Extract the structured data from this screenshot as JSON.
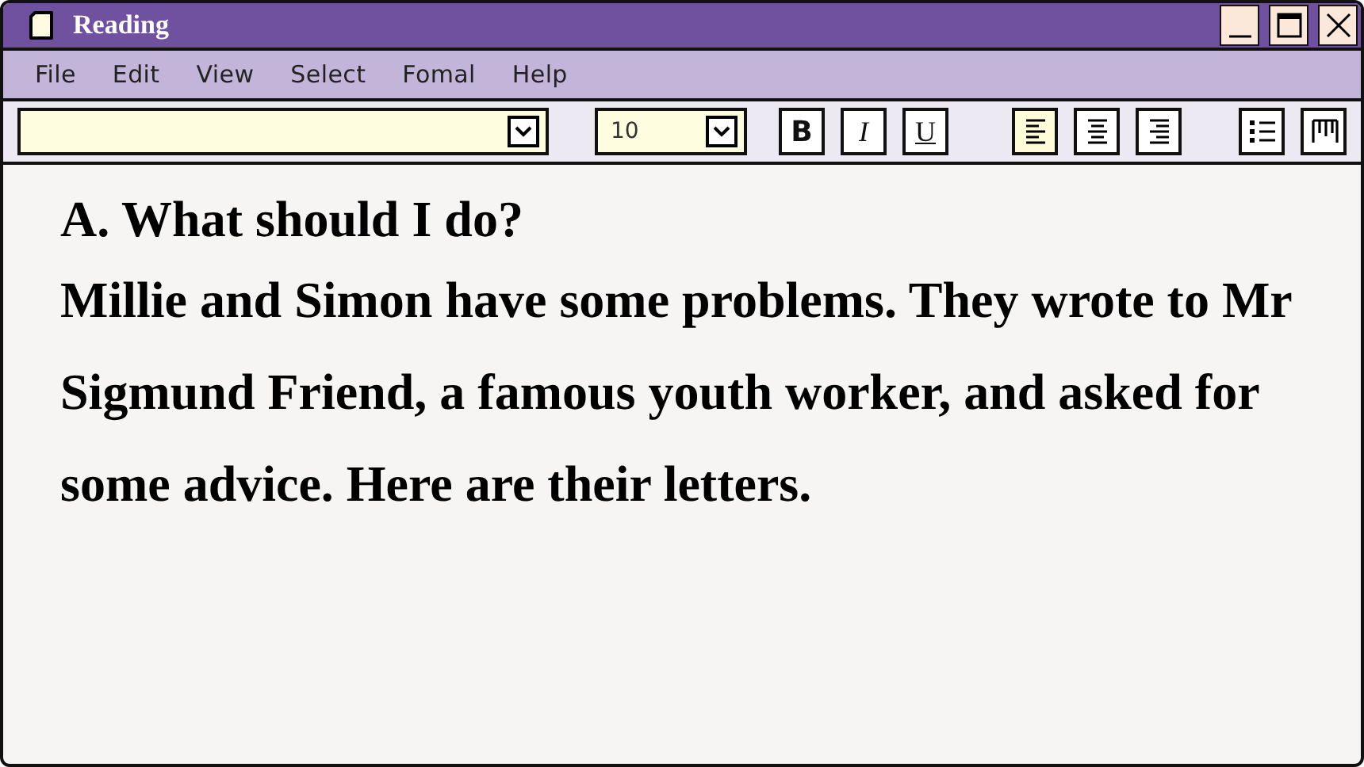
{
  "window": {
    "title": "Reading"
  },
  "menu": [
    "File",
    "Edit",
    "View",
    "Select",
    "Fomal",
    "Help"
  ],
  "toolbar": {
    "size": {
      "value": "10"
    },
    "styles": [
      {
        "label": "B",
        "kind": "bold"
      },
      {
        "label": "I",
        "kind": "italic"
      },
      {
        "label": "U",
        "kind": "underline"
      }
    ],
    "alignments": [
      {
        "kind": "left",
        "selected": true
      },
      {
        "kind": "center",
        "selected": false
      },
      {
        "kind": "right",
        "selected": false
      }
    ],
    "extras": [
      {
        "kind": "list"
      },
      {
        "kind": "columns"
      }
    ]
  },
  "document": {
    "heading": "A. What should I do?",
    "paragraph": "Millie and Simon have some problems. They wrote to Mr Sigmund Friend, a famous youth worker, and asked for some advice. Here are their letters."
  }
}
